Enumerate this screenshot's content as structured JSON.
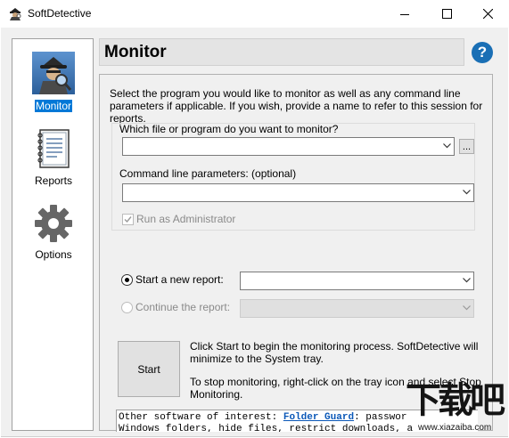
{
  "window": {
    "title": "SoftDetective",
    "app_icon": "spy-detective-icon"
  },
  "nav": {
    "items": [
      {
        "label": "Monitor",
        "icon": "detective-icon",
        "active": true
      },
      {
        "label": "Reports",
        "icon": "report-notebook-icon",
        "active": false
      },
      {
        "label": "Options",
        "icon": "gear-icon",
        "active": false
      }
    ]
  },
  "header": {
    "title": "Monitor",
    "help_label": "?"
  },
  "main": {
    "intro": "Select the program you would like to monitor as well as any command line parameters if applicable. If you wish, provide a name to refer to this session for reports.",
    "group": {
      "program_label": "Which file or program do you want to monitor?",
      "program_value": "",
      "browse_label": "...",
      "params_label": "Command line parameters: (optional)",
      "params_value": "",
      "run_admin_label": "Run as Administrator",
      "run_admin_checked": true,
      "run_admin_enabled": false
    },
    "report": {
      "new_label": "Start a new report:",
      "new_selected": true,
      "new_value": "",
      "continue_label": "Continue the report:",
      "continue_enabled": false
    },
    "start": {
      "button_label": "Start",
      "text1": "Click Start to begin the monitoring process. SoftDetective will minimize to the System tray.",
      "text2": "To stop monitoring, right-click on the tray icon and select Stop Monitoring."
    },
    "info": {
      "line1_prefix": "Other software of interest: ",
      "line1_link": "Folder Guard",
      "line1_suffix": ": passwor",
      "line2": "Windows folders, hide files, restrict downloads, a"
    }
  },
  "watermark": {
    "text": "下载吧",
    "url": "www.xiazaiba.com"
  },
  "colors": {
    "accent": "#0078d7",
    "help": "#1a6fb5",
    "link": "#0b58b8",
    "panel": "#f0f0f0"
  }
}
